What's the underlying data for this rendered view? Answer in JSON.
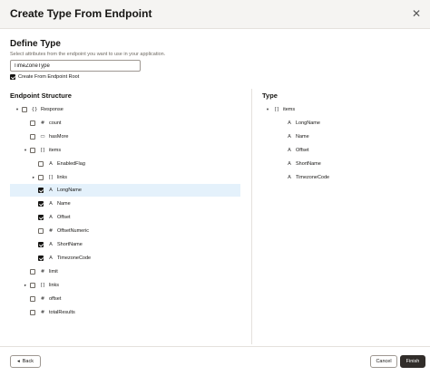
{
  "dialog": {
    "title": "Create Type From Endpoint",
    "close_glyph": "✕"
  },
  "define": {
    "heading": "Define Type",
    "description": "Select attributes from the endpoint you want to use in your application.",
    "name_value": "TimeZoneType",
    "root_checkbox_label": "Create From Endpoint Root",
    "root_checked": true
  },
  "endpoint": {
    "heading": "Endpoint Structure",
    "rows": [
      {
        "label": "Response",
        "icon": "{}",
        "icon_name": "object-icon",
        "toggle": "▾",
        "level": 0,
        "checked": false,
        "selected": false
      },
      {
        "label": "count",
        "icon": "#",
        "icon_name": "number-icon",
        "toggle": "",
        "level": 1,
        "checked": false,
        "selected": false
      },
      {
        "label": "hasMore",
        "icon": "▭",
        "icon_name": "boolean-icon",
        "toggle": "",
        "level": 1,
        "checked": false,
        "selected": false
      },
      {
        "label": "items",
        "icon": "[]",
        "icon_name": "array-icon",
        "toggle": "▾",
        "level": 1,
        "checked": false,
        "selected": false
      },
      {
        "label": "EnabledFlag",
        "icon": "A",
        "icon_name": "string-icon",
        "toggle": "",
        "level": 2,
        "checked": false,
        "selected": false
      },
      {
        "label": "links",
        "icon": "[]",
        "icon_name": "array-icon",
        "toggle": "▸",
        "level": 2,
        "checked": false,
        "selected": false
      },
      {
        "label": "LongName",
        "icon": "A",
        "icon_name": "string-icon",
        "toggle": "",
        "level": 2,
        "checked": true,
        "selected": true
      },
      {
        "label": "Name",
        "icon": "A",
        "icon_name": "string-icon",
        "toggle": "",
        "level": 2,
        "checked": true,
        "selected": false
      },
      {
        "label": "Offset",
        "icon": "A",
        "icon_name": "string-icon",
        "toggle": "",
        "level": 2,
        "checked": true,
        "selected": false
      },
      {
        "label": "OffsetNumeric",
        "icon": "#",
        "icon_name": "number-icon",
        "toggle": "",
        "level": 2,
        "checked": false,
        "selected": false
      },
      {
        "label": "ShortName",
        "icon": "A",
        "icon_name": "string-icon",
        "toggle": "",
        "level": 2,
        "checked": true,
        "selected": false
      },
      {
        "label": "TimezoneCode",
        "icon": "A",
        "icon_name": "string-icon",
        "toggle": "",
        "level": 2,
        "checked": true,
        "selected": false
      },
      {
        "label": "limit",
        "icon": "#",
        "icon_name": "number-icon",
        "toggle": "",
        "level": 1,
        "checked": false,
        "selected": false
      },
      {
        "label": "links",
        "icon": "[]",
        "icon_name": "array-icon",
        "toggle": "▸",
        "level": 1,
        "checked": false,
        "selected": false
      },
      {
        "label": "offset",
        "icon": "#",
        "icon_name": "number-icon",
        "toggle": "",
        "level": 1,
        "checked": false,
        "selected": false
      },
      {
        "label": "totalResults",
        "icon": "#",
        "icon_name": "number-icon",
        "toggle": "",
        "level": 1,
        "checked": false,
        "selected": false
      }
    ]
  },
  "type_panel": {
    "heading": "Type",
    "rows": [
      {
        "label": "items",
        "icon": "[]",
        "icon_name": "array-icon",
        "toggle": "▾",
        "level": 0
      },
      {
        "label": "LongName",
        "icon": "A",
        "icon_name": "string-icon",
        "toggle": "",
        "level": 1
      },
      {
        "label": "Name",
        "icon": "A",
        "icon_name": "string-icon",
        "toggle": "",
        "level": 1
      },
      {
        "label": "Offset",
        "icon": "A",
        "icon_name": "string-icon",
        "toggle": "",
        "level": 1
      },
      {
        "label": "ShortName",
        "icon": "A",
        "icon_name": "string-icon",
        "toggle": "",
        "level": 1
      },
      {
        "label": "TimezoneCode",
        "icon": "A",
        "icon_name": "string-icon",
        "toggle": "",
        "level": 1
      }
    ]
  },
  "footer": {
    "back_glyph": "◂",
    "back_label": "Back",
    "cancel_label": "Cancel",
    "finish_label": "Finish"
  },
  "colors": {
    "header_bg": "#f5f4f2",
    "selected_row_bg": "#e4f1fb",
    "primary_button": "#312d2a"
  }
}
